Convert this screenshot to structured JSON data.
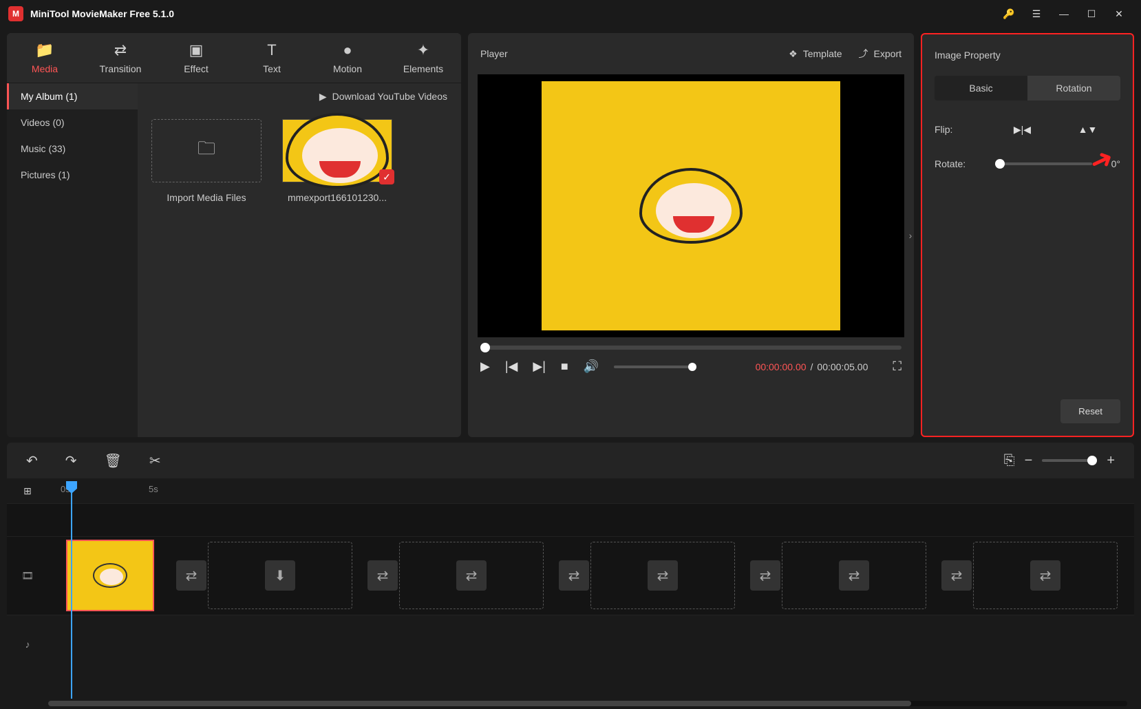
{
  "titlebar": {
    "title": "MiniTool MovieMaker Free 5.1.0"
  },
  "tabs": [
    {
      "label": "Media",
      "active": true
    },
    {
      "label": "Transition"
    },
    {
      "label": "Effect"
    },
    {
      "label": "Text"
    },
    {
      "label": "Motion"
    },
    {
      "label": "Elements"
    }
  ],
  "sidebar": {
    "items": [
      {
        "label": "My Album (1)",
        "active": true
      },
      {
        "label": "Videos (0)"
      },
      {
        "label": "Music (33)"
      },
      {
        "label": "Pictures (1)"
      }
    ]
  },
  "media": {
    "download_label": "Download YouTube Videos",
    "import_label": "Import Media Files",
    "clip_name": "mmexport166101230..."
  },
  "player": {
    "title": "Player",
    "template_label": "Template",
    "export_label": "Export",
    "current_time": "00:00:00.00",
    "separator": "/",
    "total_time": "00:00:05.00"
  },
  "props": {
    "title": "Image Property",
    "tab_basic": "Basic",
    "tab_rotation": "Rotation",
    "flip_label": "Flip:",
    "rotate_label": "Rotate:",
    "rotate_value": "0°",
    "reset_label": "Reset"
  },
  "timeline": {
    "mark0": "0s",
    "mark5": "5s"
  }
}
